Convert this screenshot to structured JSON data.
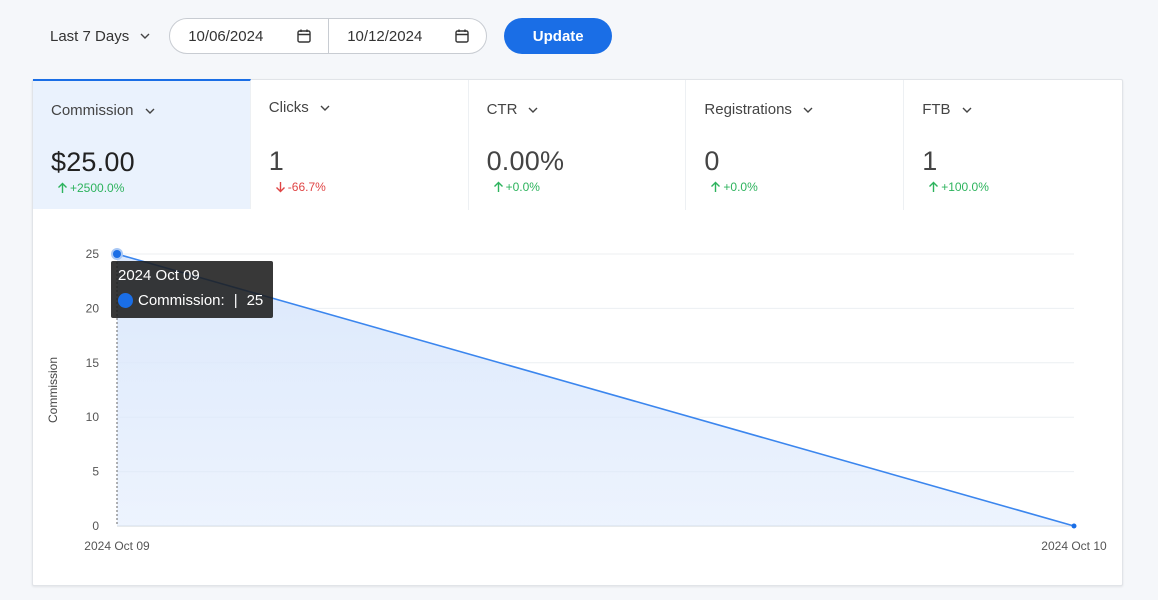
{
  "toolbar": {
    "range_label": "Last 7 Days",
    "start_date": "10/06/2024",
    "end_date": "10/12/2024",
    "update_label": "Update"
  },
  "metrics": [
    {
      "label": "Commission",
      "value": "$25.00",
      "delta": "+2500.0%",
      "direction": "up"
    },
    {
      "label": "Clicks",
      "value": "1",
      "delta": "-66.7%",
      "direction": "down"
    },
    {
      "label": "CTR",
      "value": "0.00%",
      "delta": "+0.0%",
      "direction": "up"
    },
    {
      "label": "Registrations",
      "value": "0",
      "delta": "+0.0%",
      "direction": "up"
    },
    {
      "label": "FTB",
      "value": "1",
      "delta": "+100.0%",
      "direction": "up"
    }
  ],
  "colors": {
    "accent": "#1a6ee6",
    "up": "#2db35d",
    "down": "#e04545",
    "area": "#dbe8fc",
    "line": "#3b86ee"
  },
  "chart_data": {
    "type": "area",
    "x": [
      "2024 Oct 09",
      "2024 Oct 10"
    ],
    "series": [
      {
        "name": "Commission",
        "values": [
          25,
          0
        ]
      }
    ],
    "ylabel": "Commission",
    "xlabel": "",
    "ylim": [
      0,
      25
    ],
    "yticks": [
      0,
      5,
      10,
      15,
      20,
      25
    ],
    "grid": true
  },
  "tooltip": {
    "date": "2024 Oct 09",
    "label": "Commission:",
    "separator": "|",
    "value": "25"
  }
}
